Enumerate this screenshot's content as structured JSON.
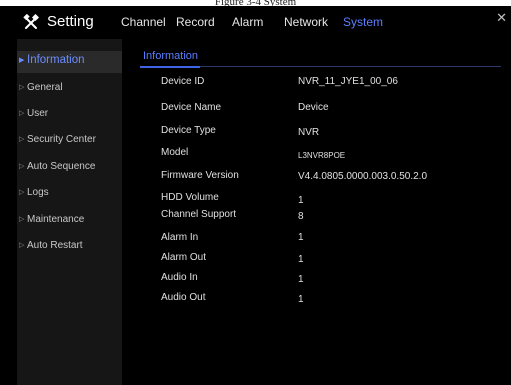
{
  "caption": "Figure 3-4 System",
  "app": {
    "title": "Setting",
    "logo_icon": "tools-icon"
  },
  "tabs": [
    {
      "label": "Channel",
      "active": false
    },
    {
      "label": "Record",
      "active": false
    },
    {
      "label": "Alarm",
      "active": false
    },
    {
      "label": "Network",
      "active": false
    },
    {
      "label": "System",
      "active": true
    }
  ],
  "close_icon": "close-icon",
  "sidebar": {
    "items": [
      {
        "label": "Information",
        "active": true
      },
      {
        "label": "General",
        "active": false
      },
      {
        "label": "User",
        "active": false
      },
      {
        "label": "Security Center",
        "active": false
      },
      {
        "label": "Auto Sequence",
        "active": false
      },
      {
        "label": "Logs",
        "active": false
      },
      {
        "label": "Maintenance",
        "active": false
      },
      {
        "label": "Auto Restart",
        "active": false
      }
    ]
  },
  "content": {
    "sub_tab": "Information",
    "fields": [
      {
        "label": "Device ID",
        "value": "NVR_11_JYE1_00_06"
      },
      {
        "label": "Device Name",
        "value": "Device"
      },
      {
        "label": "Device Type",
        "value": "NVR"
      },
      {
        "label": "Model",
        "value": "L3NVR8POE"
      },
      {
        "label": "Firmware Version",
        "value": "V4.4.0805.0000.003.0.50.2.0"
      },
      {
        "label": "HDD Volume",
        "value": "1"
      },
      {
        "label": "Channel Support",
        "value": "8"
      },
      {
        "label": "Alarm In",
        "value": "1"
      },
      {
        "label": "Alarm Out",
        "value": "1"
      },
      {
        "label": "Audio In",
        "value": "1"
      },
      {
        "label": "Audio Out",
        "value": "1"
      }
    ]
  },
  "colors": {
    "background": "#000000",
    "accent": "#5b7fff",
    "sidebar_bg": "#161616",
    "text": "#e0e0e0"
  }
}
